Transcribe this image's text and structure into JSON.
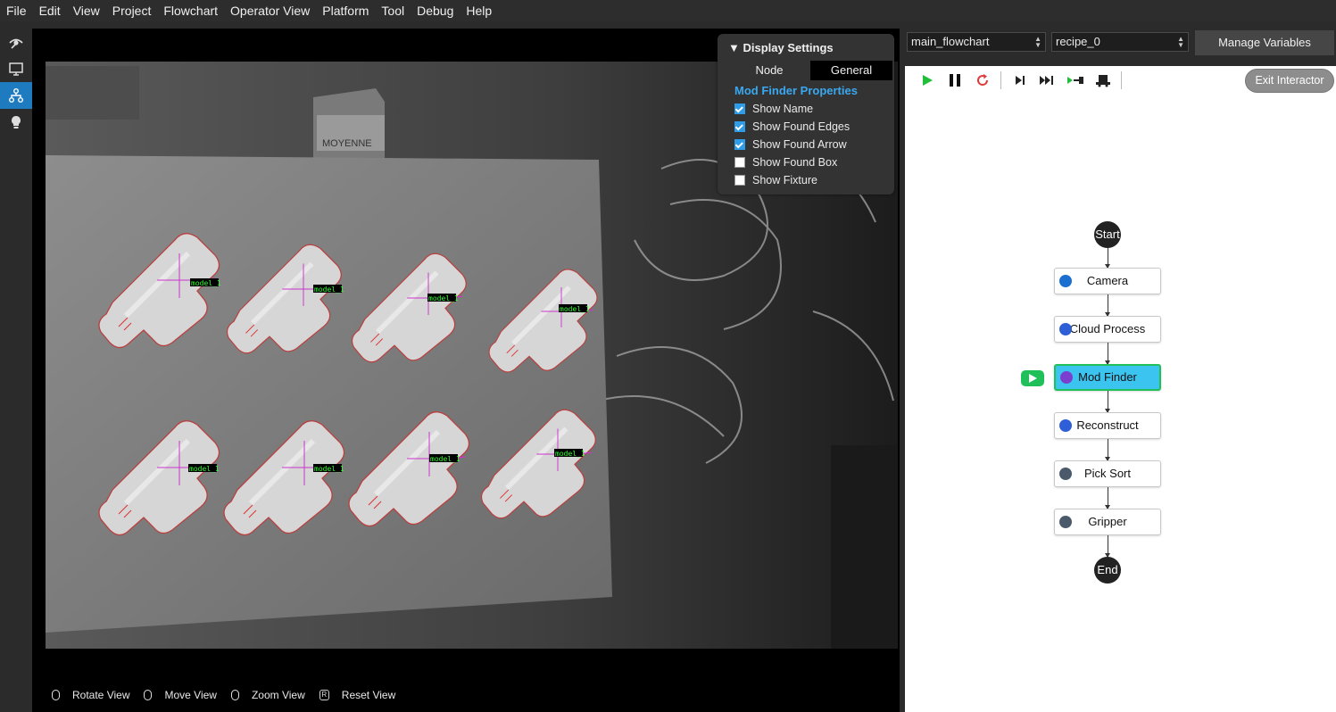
{
  "menu": [
    "File",
    "Edit",
    "View",
    "Project",
    "Flowchart",
    "Operator View",
    "Platform",
    "Tool",
    "Debug",
    "Help"
  ],
  "left_toolbar": [
    {
      "icon": "eye-wand-icon",
      "active": false
    },
    {
      "icon": "monitor-icon",
      "active": false
    },
    {
      "icon": "flowchart-icon",
      "active": true
    },
    {
      "icon": "lightbulb-icon",
      "active": false
    }
  ],
  "camera_view": {
    "model_labels": [
      "model_1",
      "model_1",
      "model_1",
      "model_1",
      "model_1",
      "model_1",
      "model_1",
      "model_1"
    ],
    "box_text": "MOYENNE"
  },
  "display_settings": {
    "title": "Display Settings",
    "tabs": [
      "Node",
      "General"
    ],
    "selected_tab": "General",
    "section": "Mod Finder Properties",
    "options": [
      {
        "label": "Show Name",
        "checked": true
      },
      {
        "label": "Show Found Edges",
        "checked": true
      },
      {
        "label": "Show Found Arrow",
        "checked": true
      },
      {
        "label": "Show Found Box",
        "checked": false
      },
      {
        "label": "Show Fixture",
        "checked": false
      }
    ]
  },
  "view_hints": [
    {
      "icon": "mouse-left-icon",
      "label": "Rotate View"
    },
    {
      "icon": "mouse-right-icon",
      "label": "Move View"
    },
    {
      "icon": "mouse-wheel-icon",
      "label": "Zoom View"
    },
    {
      "icon": "key-r-icon",
      "label": "Reset View",
      "key": "R"
    }
  ],
  "right_header": {
    "flowchart_select": "main_flowchart",
    "recipe_select": "recipe_0",
    "manage_button": "Manage Variables"
  },
  "flow_toolbar": {
    "buttons": [
      "play-icon",
      "pause-icon",
      "restart-icon",
      "step-icon",
      "step-over-icon",
      "step-into-icon",
      "step-out-icon"
    ],
    "exit_button": "Exit Interactor"
  },
  "flowchart": {
    "start": "Start",
    "end": "End",
    "nodes": [
      {
        "label": "Camera",
        "icon": "camera-icon",
        "color": "#1b6fd1",
        "active": false
      },
      {
        "label": "Cloud Process",
        "icon": "cube-icon",
        "color": "#2f5fd6",
        "active": false
      },
      {
        "label": "Mod Finder",
        "icon": "code-icon",
        "color": "#7b3fd0",
        "active": true
      },
      {
        "label": "Reconstruct",
        "icon": "cube-icon",
        "color": "#2f5fd6",
        "active": false
      },
      {
        "label": "Pick Sort",
        "icon": "wrench-icon",
        "color": "#4a5a6a",
        "active": false
      },
      {
        "label": "Gripper",
        "icon": "wrench-icon",
        "color": "#4a5a6a",
        "active": false
      }
    ]
  },
  "colors": {
    "accent": "#1f7bc0",
    "active_node": "#3cc4f0",
    "running": "#1fbf5a",
    "checkbox": "#2f9ce8"
  }
}
